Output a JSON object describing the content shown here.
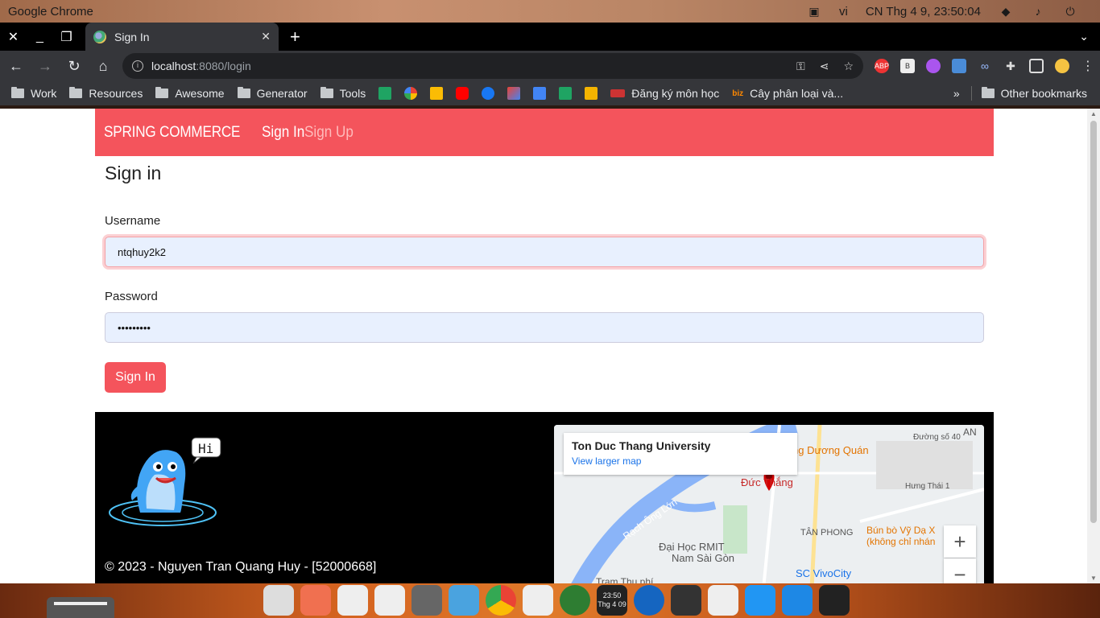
{
  "os": {
    "app_name": "Google Chrome",
    "lang": "vi",
    "datetime": "CN Thg 4  9, 23:50:04"
  },
  "browser": {
    "tab_title": "Sign In",
    "url_host": "localhost",
    "url_path": ":8080/login",
    "bookmarks": [
      "Work",
      "Resources",
      "Awesome",
      "Generator",
      "Tools"
    ],
    "bookmark_dkmh": "Đăng ký môn học",
    "bookmark_cay": "Cây phân loại và...",
    "other_bookmarks": "Other bookmarks",
    "ext_abp": "ABP",
    "ext_b": "B"
  },
  "navbar": {
    "brand": "SPRING COMMERCE",
    "signin": "Sign In",
    "signup": "Sign Up"
  },
  "form": {
    "title": "Sign in",
    "username_label": "Username",
    "username_value": "ntqhuy2k2",
    "password_label": "Password",
    "password_value": "•••••••••",
    "submit": "Sign In"
  },
  "footer": {
    "copyright": "© 2023 - Nguyen Tran Quang Huy - [52000668]",
    "mascot_text": "Hi",
    "map": {
      "place": "Ton Duc Thang University",
      "larger": "View larger map",
      "labels": {
        "duc_thang": "Đức Thắng",
        "duong_quan": "ng Dương Quán",
        "rmit": "Đại Học RMIT",
        "nam_sai_gon": "Nam Sài Gòn",
        "tan_phong": "TÂN PHONG",
        "bun_bo": "Bún bò Vỹ Dạ X",
        "khong_chi": "(không chỉ nhán",
        "vivocity": "SC VivoCity",
        "rach_ong_lon": "Rạch Ông Lớn",
        "hung_thai": "Hưng Thái 1",
        "tram_thu_phi": "Trạm Thu phí",
        "duong_so_40": "Đường số 40",
        "an": "AN"
      },
      "zoom_in": "+",
      "zoom_out": "−"
    }
  },
  "dock": {
    "clock_time": "23:50",
    "clock_date": "Thg 4 09"
  },
  "colors": {
    "brand": "#f4545c",
    "input_bg": "#e8f0fe"
  }
}
